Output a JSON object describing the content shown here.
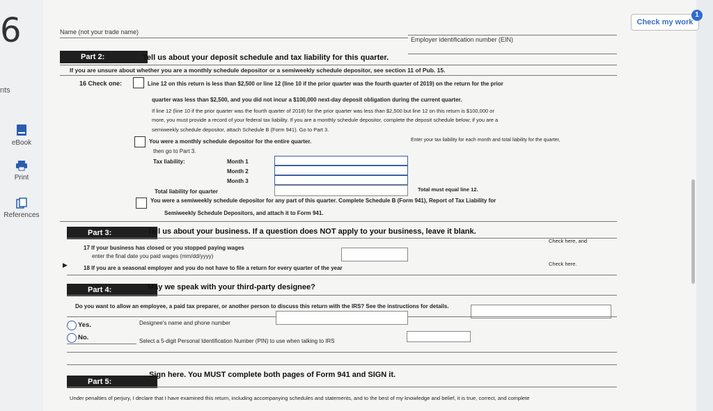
{
  "left": {
    "question_number": "6",
    "nts_label": "nts",
    "tools": [
      {
        "label": "eBook",
        "icon": "ebook-icon"
      },
      {
        "label": "Print",
        "icon": "print-icon"
      },
      {
        "label": "References",
        "icon": "references-icon"
      }
    ]
  },
  "header": {
    "check_my_work": "Check my work",
    "badge": "1"
  },
  "top": {
    "name_label": "Name (not your trade name)",
    "ein_label": "Employer identification number (EIN)"
  },
  "part2": {
    "label": "Part 2:",
    "heading": "Tell us about your deposit schedule and tax liability for this quarter.",
    "unsure": "If you are unsure about whether you are a monthly schedule depositor or a semiweekly schedule depositor, see section 11 of Pub. 15.",
    "check_one": "16 Check one:",
    "opt1_line1": "Line 12 on this return is less than $2,500 or line 12 (line 10 if the prior quarter was the fourth quarter of 2019) on the return for the prior",
    "opt1_line2": "quarter was less than $2,500, and you did not incur a $100,000 next-day deposit obligation during the current quarter.",
    "opt1_line3": "If line 12 (line 10 if the prior quarter was the fourth quarter of 2018) for the prior quarter was less than $2,500 but line 12 on this return is $100,000 or",
    "opt1_line4": "more, you must provide a record of your federal tax liability. If you are a monthly schedule depositor, complete the deposit schedule below; if you are a",
    "opt1_line5": "semiweekly schedule depositor, attach Schedule B (Form 941). Go to Part 3.",
    "opt2_line1": "You were a monthly schedule depositor for the entire quarter.",
    "opt2_right": "Enter your tax liability for each month and total liability for the quarter,",
    "opt2_line2": "then go to Part 3.",
    "tax_liability": "Tax liability:",
    "month1": "Month 1",
    "month2": "Month 2",
    "month3": "Month 3",
    "total_liability": "Total liability for quarter",
    "total_must": "Total must equal line 12.",
    "opt3_line1": "You were a semiweekly schedule depositor for any part of this quarter. Complete Schedule B (Form 941), Report of Tax Liability for",
    "opt3_line2": "Semiweekly Schedule Depositors, and attach it to Form 941."
  },
  "part3": {
    "label": "Part 3:",
    "heading": "Tell us about your business.  If a question does NOT apply to your business, leave it blank.",
    "q17_line1": "17 If your business has closed or you stopped paying wages",
    "q17_line2": "enter the final date you paid wages (mm/dd/yyyy)",
    "check_here_and": "Check here, and",
    "q18": "18 If you are a seasonal employer and you do not have to file a return for every quarter of the year",
    "check_here": "Check here."
  },
  "part4": {
    "label": "Part 4:",
    "heading": "May we speak with your third-party designee?",
    "question": "Do you want to allow an employee, a paid tax preparer, or another person to discuss this return with the IRS?  See the instructions for details.",
    "yes": "Yes.",
    "no": "No.",
    "designee_name": "Designee's name and phone number",
    "pin": "Select a 5-digit Personal Identification Number (PIN) to use when talking to IRS"
  },
  "part5": {
    "label": "Part 5:",
    "heading": "Sign here.  You MUST complete both pages of Form 941 and SIGN it.",
    "penalties": "Under penalties of perjury, I declare that I have examined this return, including accompanying schedules and statements, and to the best of my knowledge and belief, it is true, correct, and complete"
  }
}
